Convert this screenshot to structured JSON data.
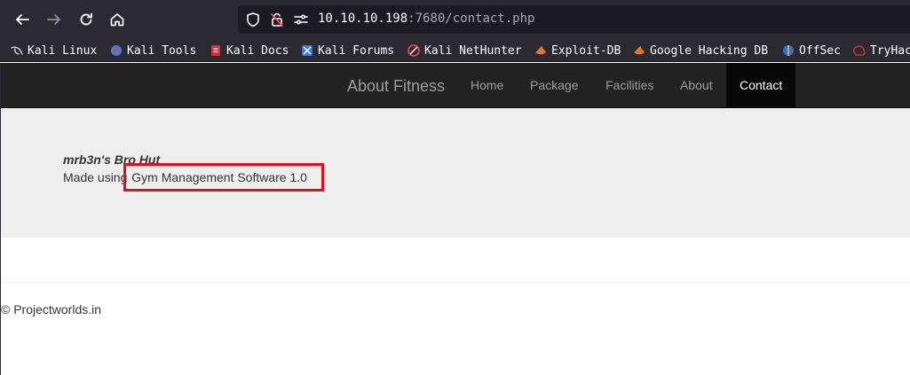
{
  "browser": {
    "url_host": "10.10.10.198",
    "url_rest": ":7680/contact.php",
    "bookmarks": [
      {
        "label": "Kali Linux",
        "icon": "kali-dragon-icon"
      },
      {
        "label": "Kali Tools",
        "icon": "kali-tools-icon"
      },
      {
        "label": "Kali Docs",
        "icon": "kali-docs-icon"
      },
      {
        "label": "Kali Forums",
        "icon": "kali-forums-icon"
      },
      {
        "label": "Kali NetHunter",
        "icon": "kali-nethunter-icon"
      },
      {
        "label": "Exploit-DB",
        "icon": "exploit-db-icon"
      },
      {
        "label": "Google Hacking DB",
        "icon": "ghdb-icon"
      },
      {
        "label": "OffSec",
        "icon": "offsec-icon"
      },
      {
        "label": "TryHac",
        "icon": "tryhackme-icon"
      }
    ]
  },
  "site": {
    "brand": "About Fitness",
    "nav": [
      {
        "label": "Home"
      },
      {
        "label": "Package"
      },
      {
        "label": "Facilities"
      },
      {
        "label": "About"
      },
      {
        "label": "Contact",
        "active": true
      }
    ],
    "jumbotron": {
      "title": "mrb3n's Bro Hut",
      "made_using_prefix": "Made using",
      "software": "Gym Management Software 1.0"
    },
    "footer": "© Projectworlds.in"
  },
  "colors": {
    "toolbar": "#2b2a33",
    "navbar": "#222222",
    "active_nav": "#080808",
    "jumbotron": "#eeeeee",
    "highlight": "#e0101a"
  }
}
